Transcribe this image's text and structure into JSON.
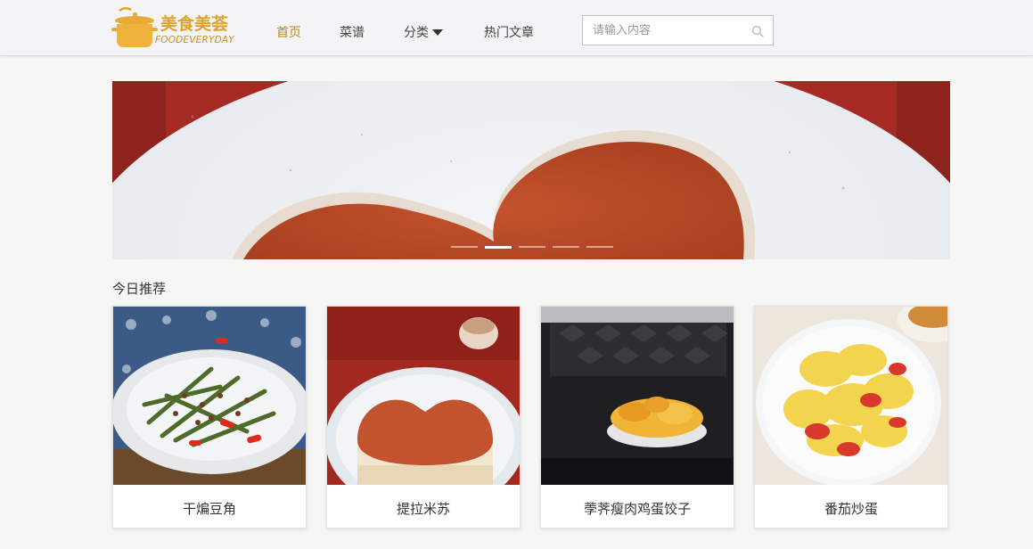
{
  "header": {
    "logo": {
      "cn": "美食美荟",
      "en": "FOODEVERYDAY"
    },
    "nav": [
      {
        "label": "首页",
        "active": true
      },
      {
        "label": "菜谱",
        "active": false
      },
      {
        "label": "分类",
        "active": false,
        "dropdown": true
      },
      {
        "label": "热门文章",
        "active": false
      }
    ],
    "search": {
      "placeholder": "请输入内容",
      "value": "",
      "icon": "search-icon"
    }
  },
  "banner": {
    "slides": 5,
    "active_slide": 2,
    "image": "tiramisu-heart-closeup"
  },
  "recommend": {
    "title": "今日推荐",
    "items": [
      {
        "label": "干煸豆角",
        "image": "dry-fried-green-beans"
      },
      {
        "label": "提拉米苏",
        "image": "heart-tiramisu"
      },
      {
        "label": "荸荠瘦肉鸡蛋饺子",
        "image": "egg-dumplings-in-microwave"
      },
      {
        "label": "番茄炒蛋",
        "image": "tomato-scrambled-eggs"
      }
    ]
  },
  "colors": {
    "accent": "#b8862a",
    "logo": "#e0a32a",
    "header_bg": "#f4f4f6",
    "page_bg": "#f6f6f4"
  }
}
